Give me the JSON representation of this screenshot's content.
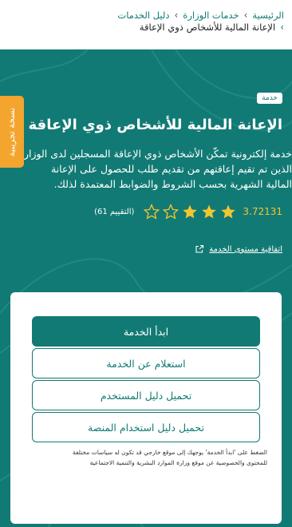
{
  "breadcrumb": {
    "home": "الرئيسية",
    "ministry_services": "خدمات الوزارة",
    "services_guide": "دليل الخدمات",
    "current": "الإعانة المالية للأشخاص ذوي الإعاقة"
  },
  "service": {
    "tag": "خدمة",
    "title": "الإعانة المالية للأشخاص ذوي الإعاقة",
    "description_lines": [
      "خدمة إلكترونية تمكّن الأشخاص ذوي الإعاقة المسجلين لدى الوزارة",
      "الذين تم تقيم إعاقتهم من تقديم طلب للحصول على الإعانة",
      "المالية الشهرية بحسب الشروط والضوابط المعتمدة لذلك."
    ],
    "rating_value": "3.72131",
    "rating_stars": 3.5,
    "rating_count_text": "(التقييم 61)",
    "sla_link": "اتفاقية مستوى الخدمة"
  },
  "side_tab": {
    "label": "نسخة تجريبية"
  },
  "actions": {
    "start": "ابدأ الخدمة",
    "inquire": "استعلام عن الخدمة",
    "user_guide": "تحميل دليل المستخدم",
    "platform_guide": "تحميل دليل استخدام المنصة"
  },
  "disclaimer_lines": [
    "الضغط على 'ابدأ الخدمة' يوجهك إلى موقع خارجي قد تكون له سياسات مختلفة",
    "للمحتوى والخصوصية عن موقع وزارة الموارد البشرية والتنمية الاجتماعية"
  ],
  "colors": {
    "primary": "#127a74",
    "accent_star": "#f2c531",
    "side_tab": "#f3a52e"
  },
  "icons": {
    "breadcrumb_separator": "chevron-right-icon",
    "star": "star-icon",
    "external_link": "external-link-icon"
  }
}
